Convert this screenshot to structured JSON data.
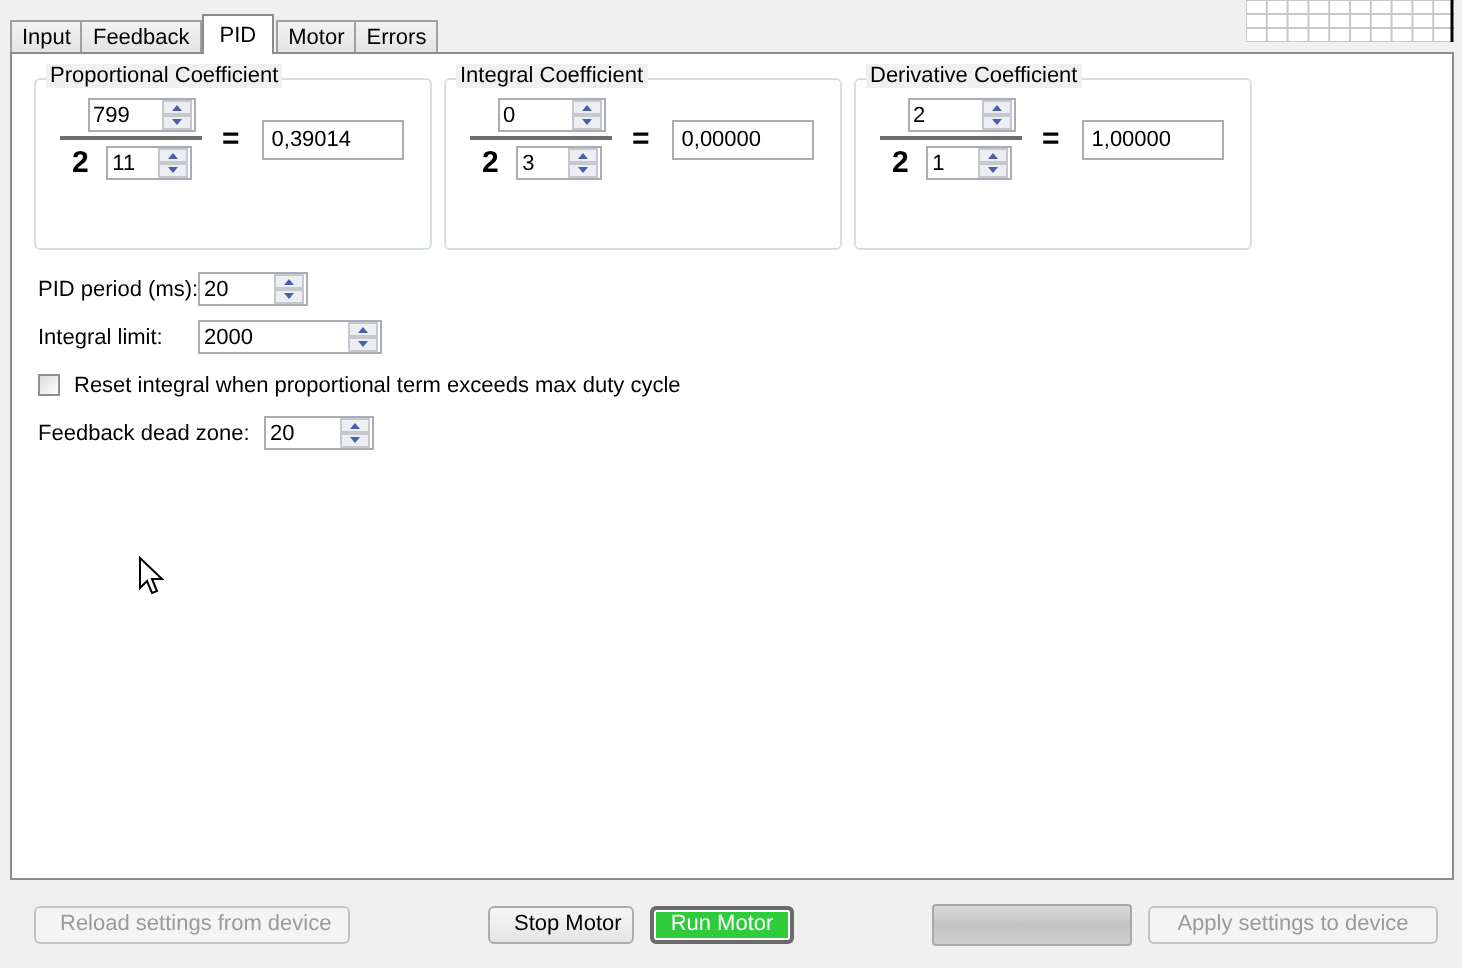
{
  "tabs": [
    {
      "label": "Input",
      "selected": false
    },
    {
      "label": "Feedback",
      "selected": false
    },
    {
      "label": "PID",
      "selected": true
    },
    {
      "label": "Motor",
      "selected": false
    },
    {
      "label": "Errors",
      "selected": false
    }
  ],
  "coefficients": [
    {
      "title": "Proportional Coefficient",
      "numerator": "799",
      "base": "2",
      "exponent": "11",
      "equals": "=",
      "result": "0,39014"
    },
    {
      "title": "Integral Coefficient",
      "numerator": "0",
      "base": "2",
      "exponent": "3",
      "equals": "=",
      "result": "0,00000"
    },
    {
      "title": "Derivative Coefficient",
      "numerator": "2",
      "base": "2",
      "exponent": "1",
      "equals": "=",
      "result": "1,00000"
    }
  ],
  "settings": [
    {
      "kind": "spin",
      "label": "PID period (ms):",
      "value": "20"
    },
    {
      "kind": "spin",
      "label": "Integral limit:",
      "value": "2000"
    },
    {
      "kind": "checkbox",
      "label": "Reset integral when proportional term exceeds max duty cycle",
      "checked": false
    },
    {
      "kind": "spin",
      "label": "Feedback dead zone:",
      "value": "20"
    }
  ],
  "buttons": [
    {
      "label": "Reload settings from device",
      "disabled": true,
      "highlighted": false
    },
    {
      "label": "Stop Motor",
      "disabled": false,
      "highlighted": false
    },
    {
      "label": "Run Motor",
      "disabled": false,
      "highlighted": true
    },
    {
      "label": "Apply settings to device",
      "disabled": true,
      "highlighted": false
    }
  ],
  "progress_bar": {
    "level": 0
  }
}
